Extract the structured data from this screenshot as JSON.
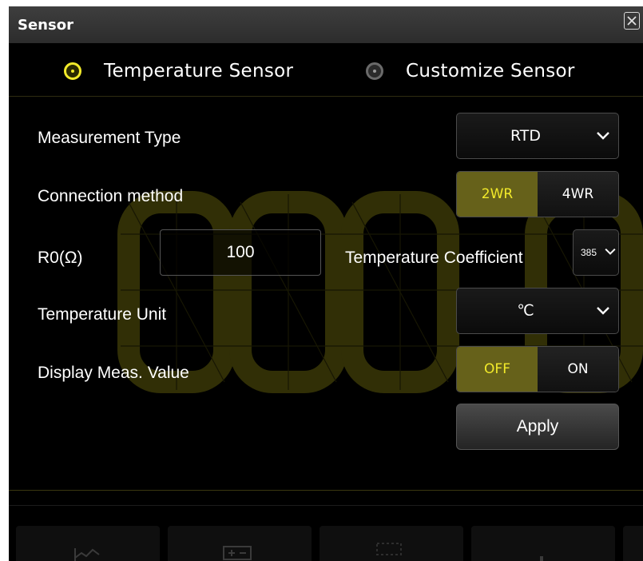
{
  "dialog": {
    "title": "Sensor"
  },
  "sensor_type": {
    "options": [
      {
        "label": "Temperature Sensor",
        "selected": true
      },
      {
        "label": "Customize Sensor",
        "selected": false
      }
    ]
  },
  "form": {
    "measurement_type": {
      "label": "Measurement Type",
      "value": "RTD"
    },
    "connection_method": {
      "label": "Connection method",
      "options": [
        "2WR",
        "4WR"
      ],
      "selected": "2WR"
    },
    "r0": {
      "label": "R0(Ω)",
      "value": "100"
    },
    "temperature_coefficient": {
      "label": "Temperature Coefficient",
      "value": "385"
    },
    "temperature_unit": {
      "label": "Temperature Unit",
      "value": "℃"
    },
    "display_meas_value": {
      "label": "Display Meas. Value",
      "options": [
        "OFF",
        "ON"
      ],
      "selected": "OFF"
    },
    "apply_label": "Apply"
  },
  "colors": {
    "accent": "#f2ea2a",
    "active_segment": "#66611a",
    "background": "#000000",
    "titlebar": "#333333"
  },
  "icons": [
    "close-icon",
    "chevron-down-icon",
    "radio-selected-icon",
    "radio-unselected-icon"
  ]
}
